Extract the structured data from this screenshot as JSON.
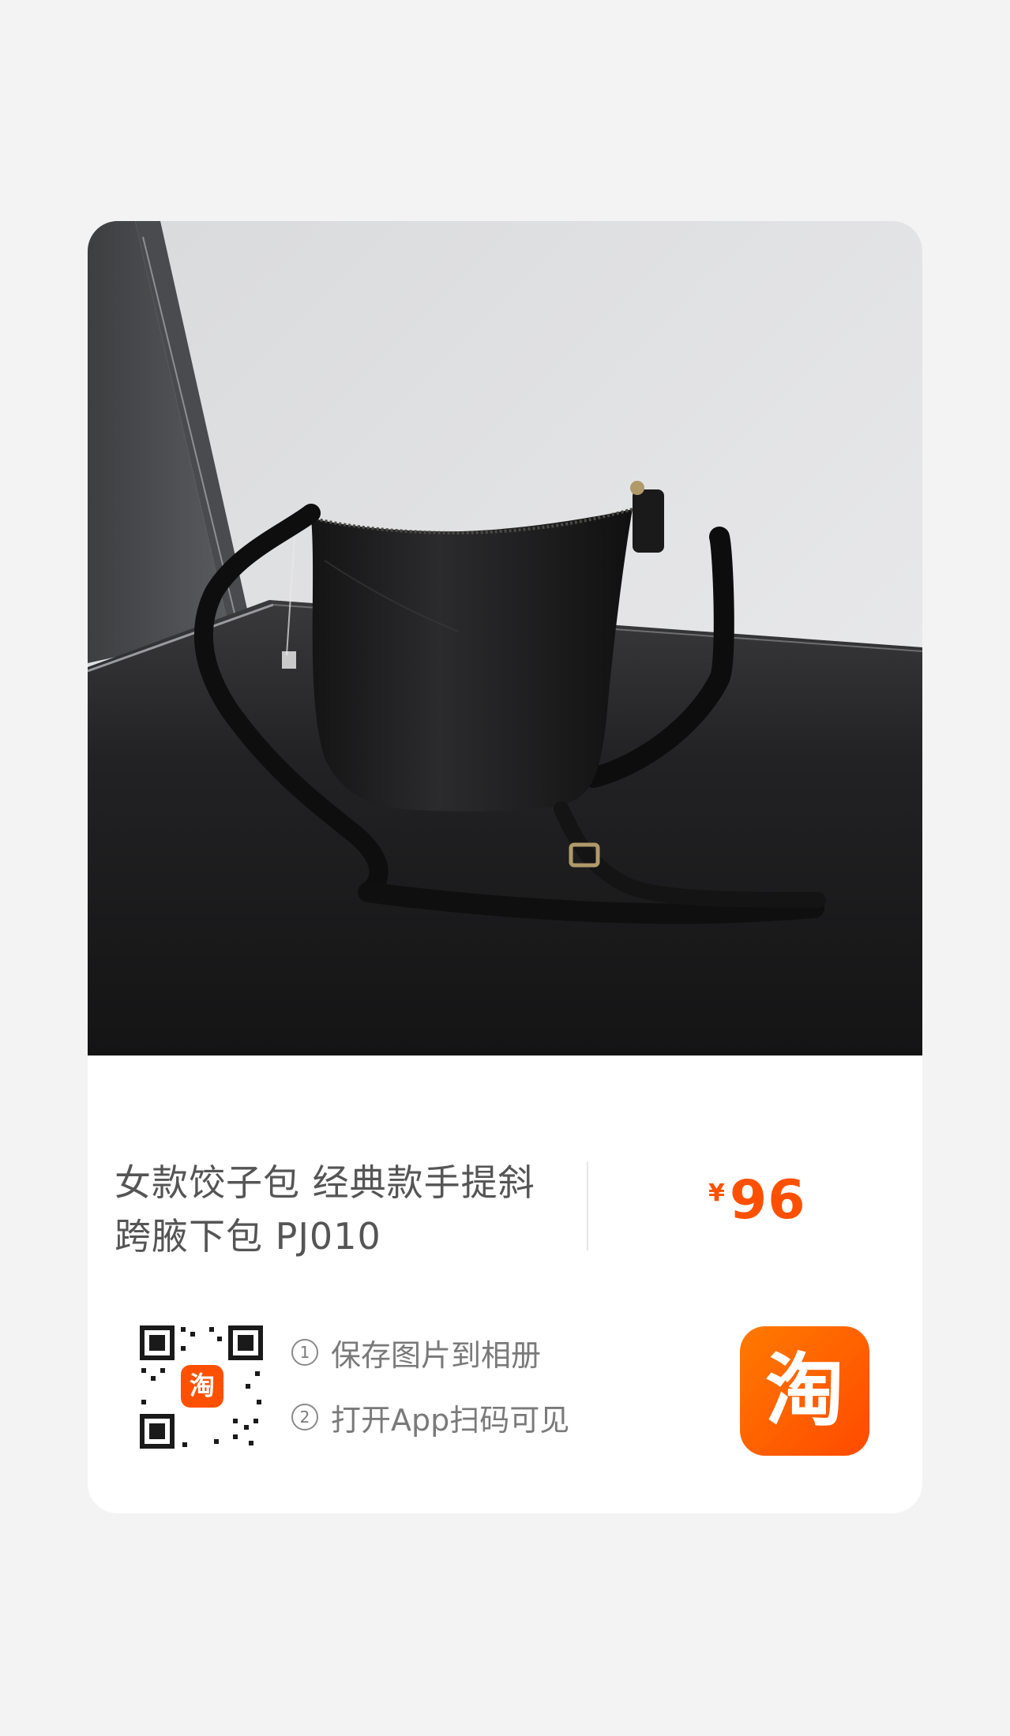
{
  "product": {
    "title": "女款饺子包 经典款手提斜跨腋下包 PJ010",
    "price": {
      "currency": "¥",
      "value": "96"
    },
    "image": {
      "subject": "black-leather-crossbody-bag"
    }
  },
  "share": {
    "qr_logo_char": "淘",
    "steps": [
      {
        "num": "1",
        "label": "保存图片到相册"
      },
      {
        "num": "2",
        "label": "打开App扫码可见"
      }
    ],
    "app_icon_char": "淘"
  },
  "colors": {
    "accent": "#ff5000",
    "page_background": "#f3f3f3",
    "card_background": "#ffffff",
    "title_text": "#555555",
    "step_text": "#7a7a7a"
  }
}
